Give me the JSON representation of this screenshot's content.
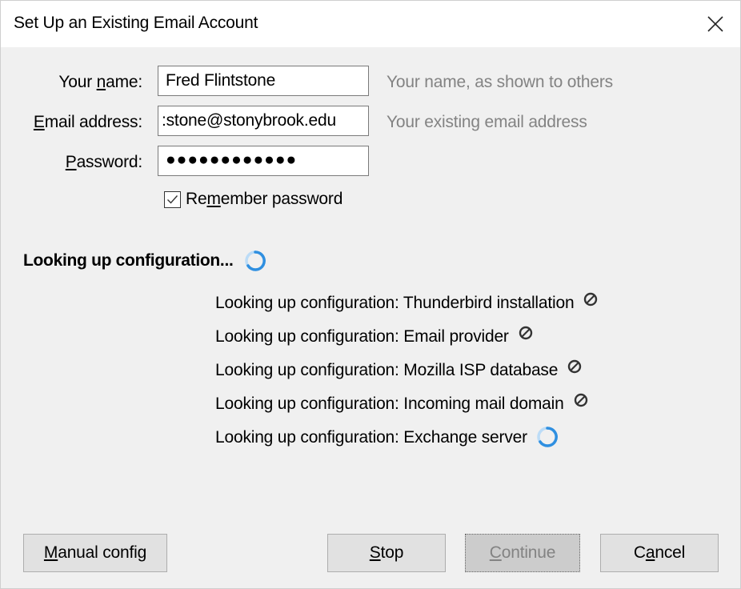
{
  "window": {
    "title": "Set Up an Existing Email Account",
    "close_icon": "close-icon"
  },
  "form": {
    "name": {
      "label_pre": "Your ",
      "label_accel": "n",
      "label_post": "ame:",
      "value": "Fred Flintstone",
      "hint": "Your name, as shown to others"
    },
    "email": {
      "label_pre": "",
      "label_accel": "E",
      "label_post": "mail address:",
      "value": ":stone@stonybrook.edu",
      "hint": "Your existing email address"
    },
    "password": {
      "label_pre": "",
      "label_accel": "P",
      "label_post": "assword:",
      "value": "●●●●●●●●●●●●",
      "masked_length": 12
    },
    "remember": {
      "label_pre": "Re",
      "label_accel": "m",
      "label_post": "ember password",
      "checked": true
    }
  },
  "status": {
    "text": "Looking up configuration...",
    "icon": "spinner-icon"
  },
  "steps": [
    {
      "text": "Looking up configuration: Thunderbird installation",
      "state": "failed",
      "icon": "blocked-icon"
    },
    {
      "text": "Looking up configuration: Email provider",
      "state": "failed",
      "icon": "blocked-icon"
    },
    {
      "text": "Looking up configuration: Mozilla ISP database",
      "state": "failed",
      "icon": "blocked-icon"
    },
    {
      "text": "Looking up configuration: Incoming mail domain",
      "state": "failed",
      "icon": "blocked-icon"
    },
    {
      "text": "Looking up configuration: Exchange server",
      "state": "in-progress",
      "icon": "spinner-icon"
    }
  ],
  "buttons": {
    "manual": {
      "accel": "M",
      "rest": "anual config",
      "enabled": true
    },
    "stop": {
      "accel": "S",
      "rest": "top",
      "enabled": true
    },
    "continue": {
      "accel": "C",
      "rest": "ontinue",
      "enabled": false
    },
    "cancel": {
      "pre": "C",
      "accel": "a",
      "rest": "ncel",
      "enabled": true
    }
  },
  "colors": {
    "spinner": "#2f8fe0",
    "hint_text": "#838383",
    "disabled_text": "#838383"
  }
}
